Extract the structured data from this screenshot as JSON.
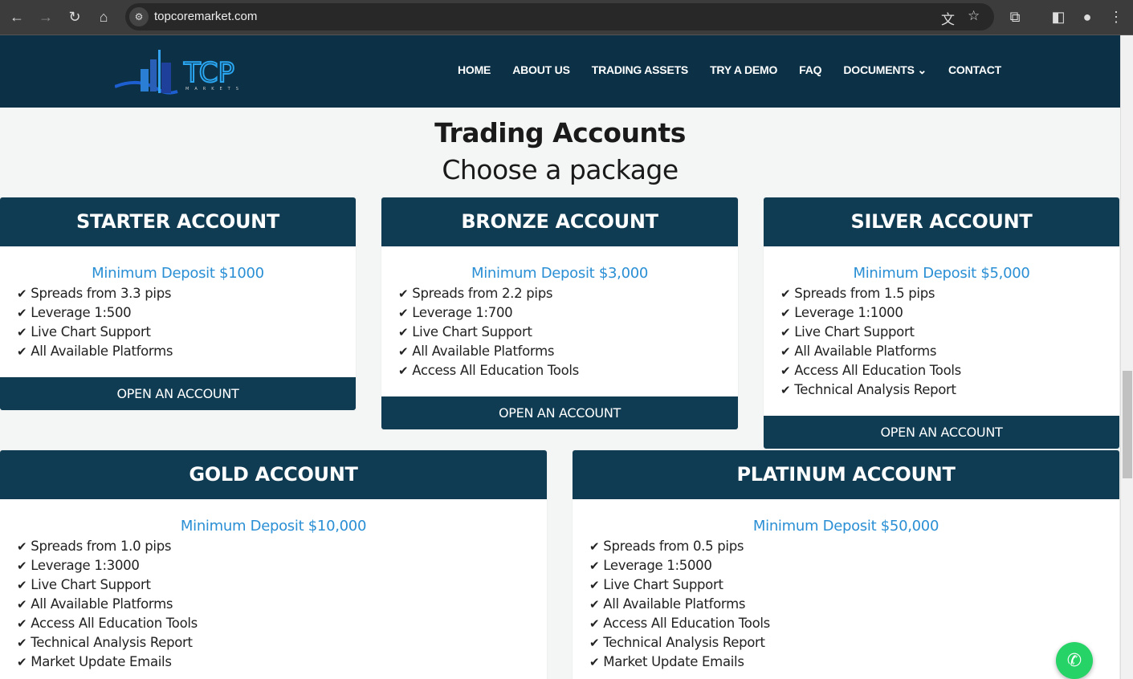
{
  "browser": {
    "url": "topcoremarket.com"
  },
  "nav": {
    "logo_text": "TCP",
    "logo_sub": "MARKETS",
    "items": [
      "HOME",
      "ABOUT US",
      "TRADING ASSETS",
      "TRY A DEMO",
      "FAQ",
      "DOCUMENTS",
      "CONTACT"
    ]
  },
  "page": {
    "title": "Trading Accounts",
    "subtitle": "Choose a package"
  },
  "cards": [
    {
      "title": "STARTER ACCOUNT",
      "deposit": "Minimum Deposit $1000",
      "features": [
        "Spreads from 3.3 pips",
        "Leverage 1:500",
        "Live Chart Support",
        "All Available Platforms"
      ],
      "button": "OPEN AN ACCOUNT"
    },
    {
      "title": "BRONZE ACCOUNT",
      "deposit": "Minimum Deposit $3,000",
      "features": [
        "Spreads from 2.2 pips",
        "Leverage 1:700",
        "Live Chart Support",
        "All Available Platforms",
        "Access All Education Tools"
      ],
      "button": "OPEN AN ACCOUNT"
    },
    {
      "title": "SILVER ACCOUNT",
      "deposit": "Minimum Deposit $5,000",
      "features": [
        "Spreads from 1.5 pips",
        "Leverage 1:1000",
        "Live Chart Support",
        "All Available Platforms",
        "Access All Education Tools",
        "Technical Analysis Report"
      ],
      "button": "OPEN AN ACCOUNT"
    },
    {
      "title": "GOLD ACCOUNT",
      "deposit": "Minimum Deposit $10,000",
      "features": [
        "Spreads from 1.0 pips",
        "Leverage 1:3000",
        "Live Chart Support",
        "All Available Platforms",
        "Access All Education Tools",
        "Technical Analysis Report",
        "Market Update Emails"
      ]
    },
    {
      "title": "PLATINUM ACCOUNT",
      "deposit": "Minimum Deposit $50,000",
      "features": [
        "Spreads from 0.5 pips",
        "Leverage 1:5000",
        "Live Chart Support",
        "All Available Platforms",
        "Access All Education Tools",
        "Technical Analysis Report",
        "Market Update Emails"
      ]
    }
  ],
  "colors": {
    "navy": "#0c3147",
    "card_header": "#0f3c53",
    "deposit": "#2a8fd4",
    "whatsapp": "#25d366"
  }
}
